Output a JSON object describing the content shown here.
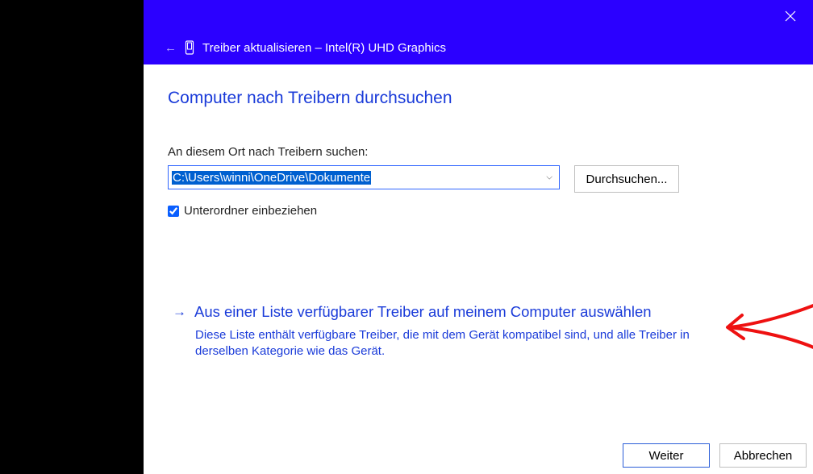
{
  "titlebar": {
    "title": "Treiber aktualisieren – Intel(R) UHD Graphics"
  },
  "heading": "Computer nach Treibern durchsuchen",
  "search_label": "An diesem Ort nach Treibern suchen:",
  "path_value": "C:\\Users\\winni\\OneDrive\\Dokumente",
  "browse_label": "Durchsuchen...",
  "subfolders_label": "Unterordner einbeziehen",
  "subfolders_checked": true,
  "option": {
    "title": "Aus einer Liste verfügbarer Treiber auf meinem Computer auswählen",
    "desc": "Diese Liste enthält verfügbare Treiber, die mit dem Gerät kompatibel sind, und alle Treiber in derselben Kategorie wie das Gerät."
  },
  "footer": {
    "next": "Weiter",
    "cancel": "Abbrechen"
  }
}
